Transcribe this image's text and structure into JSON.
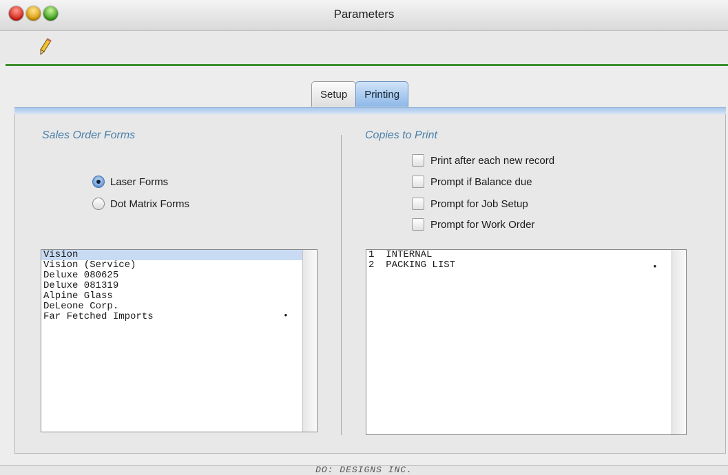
{
  "window": {
    "title": "Parameters"
  },
  "tabs": [
    {
      "label": "Setup",
      "active": false
    },
    {
      "label": "Printing",
      "active": true
    }
  ],
  "sales_order_forms": {
    "title": "Sales Order Forms",
    "radios": [
      {
        "label": "Laser Forms",
        "selected": true
      },
      {
        "label": "Dot Matrix Forms",
        "selected": false
      }
    ],
    "list": [
      "Vision",
      "Vision (Service)",
      "Deluxe 080625",
      "Deluxe 081319",
      "Alpine Glass",
      "DeLeone Corp.",
      "Far Fetched Imports"
    ],
    "selected_index": 0,
    "marker": "•"
  },
  "copies_to_print": {
    "title": "Copies to Print",
    "checkboxes": [
      {
        "label": "Print after each new record",
        "checked": false
      },
      {
        "label": "Prompt if Balance due",
        "checked": false
      },
      {
        "label": "Prompt for Job Setup",
        "checked": false
      },
      {
        "label": "Prompt for Work Order",
        "checked": false
      }
    ],
    "list": [
      "1  INTERNAL",
      "2  PACKING LIST"
    ],
    "marker": "•"
  },
  "status": {
    "text": "DO: DESIGNS INC."
  },
  "colors": {
    "accent_green": "#3d8f2e",
    "active_tab": "#8db8e8",
    "section_title": "#4a7fa8"
  }
}
